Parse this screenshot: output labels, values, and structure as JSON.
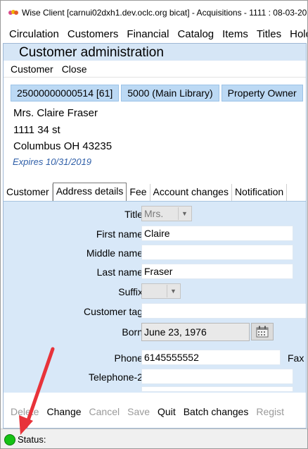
{
  "window": {
    "title": "Wise Client [carnui02dxh1.dev.oclc.org bicat] - Acquisitions - 1111 : 08-03-20"
  },
  "menu": [
    "Circulation",
    "Customers",
    "Financial",
    "Catalog",
    "Items",
    "Titles",
    "Hold"
  ],
  "panel": {
    "title": "Customer administration",
    "subtoolbar": [
      "Customer",
      "Close"
    ]
  },
  "patron": {
    "chips": [
      "25000000000514 [61]",
      "5000 (Main Library)",
      "Property Owner"
    ],
    "name": "Mrs. Claire Fraser",
    "street": "1111 34 st",
    "city": "Columbus OH 43235",
    "expires": "Expires 10/31/2019"
  },
  "tabs": [
    "Customer",
    "Address details",
    "Fee",
    "Account changes",
    "Notification"
  ],
  "form": {
    "title_label": "Title",
    "title_value": "Mrs.",
    "first_name_label": "First name",
    "first_name_value": "Claire",
    "middle_name_label": "Middle name",
    "middle_name_value": "",
    "last_name_label": "Last name",
    "last_name_value": "Fraser",
    "suffix_label": "Suffix",
    "suffix_value": "",
    "customer_tag_label": "Customer tag",
    "customer_tag_value": "",
    "born_label": "Born",
    "born_value": "June 23, 1976",
    "phone_label": "Phone",
    "phone_value": "6145555552",
    "fax_label": "Fax",
    "telephone2_label": "Telephone-2",
    "telephone2_value": ""
  },
  "actions": [
    {
      "label": "Delete",
      "enabled": false
    },
    {
      "label": "Change",
      "enabled": true
    },
    {
      "label": "Cancel",
      "enabled": false
    },
    {
      "label": "Save",
      "enabled": false
    },
    {
      "label": "Quit",
      "enabled": true
    },
    {
      "label": "Batch changes",
      "enabled": true
    },
    {
      "label": "Regist",
      "enabled": false
    }
  ],
  "status": {
    "label": "Status:",
    "indicator_color": "#15c215"
  },
  "colors": {
    "accent_panel": "#d8e8f8",
    "chip": "#bcd9f4",
    "expires_text": "#2f5fa8",
    "annotation_arrow": "#e8333a"
  }
}
